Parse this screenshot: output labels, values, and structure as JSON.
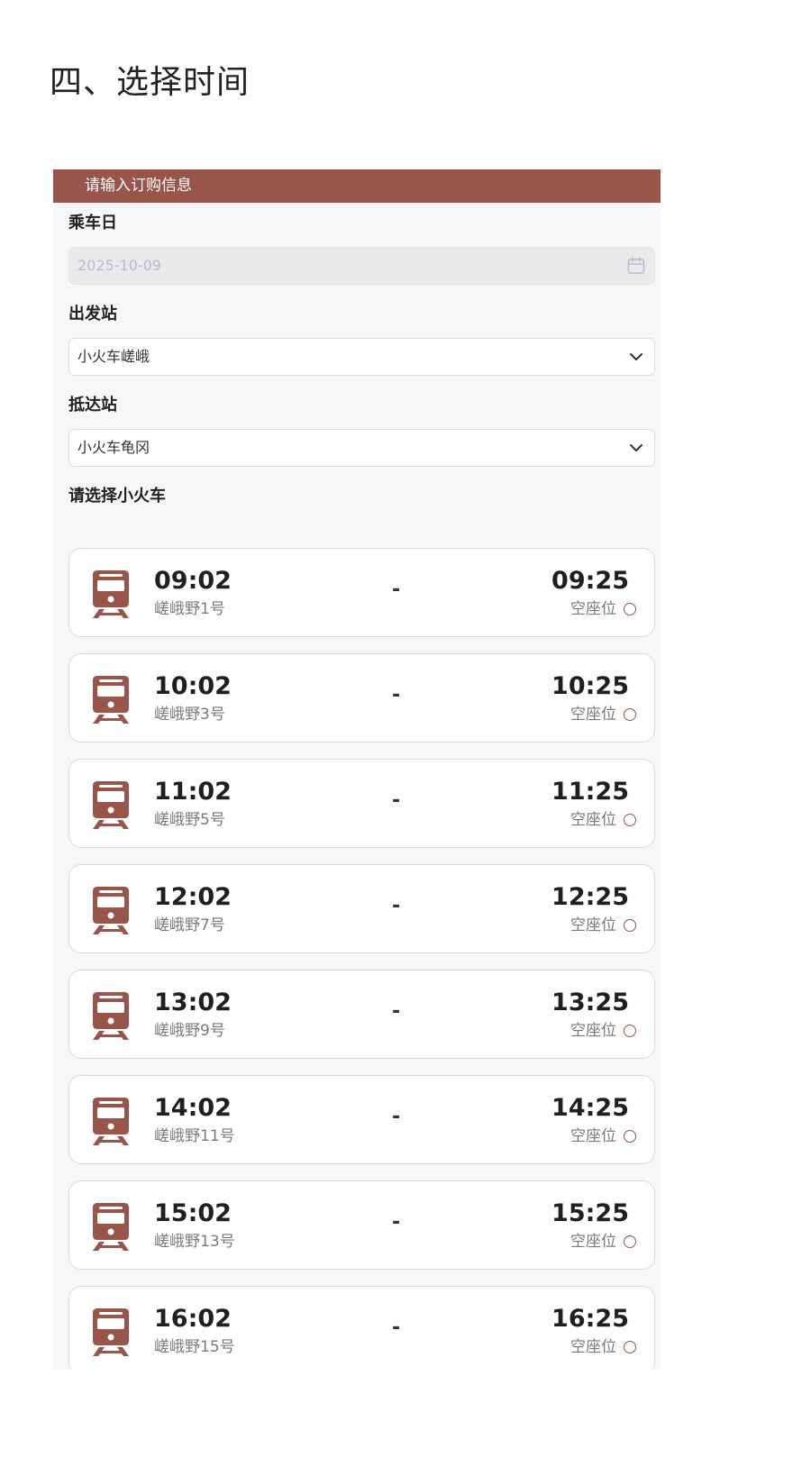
{
  "document": {
    "heading": "四、选择时间"
  },
  "form": {
    "header": "请输入订购信息",
    "date": {
      "label": "乘车日",
      "value": "2025-10-09",
      "icon": "calendar-icon"
    },
    "departure": {
      "label": "出发站",
      "value": "小火车嵯峨",
      "icon": "chevron-down-icon"
    },
    "arrival": {
      "label": "抵达站",
      "value": "小火车龟冈",
      "icon": "chevron-down-icon"
    },
    "train_section_label": "请选择小火车"
  },
  "trains": [
    {
      "dep": "09:02",
      "name": "嵯峨野1号",
      "sep": "-",
      "arr": "09:25",
      "seat": "空座位",
      "mark": "○"
    },
    {
      "dep": "10:02",
      "name": "嵯峨野3号",
      "sep": "-",
      "arr": "10:25",
      "seat": "空座位",
      "mark": "○"
    },
    {
      "dep": "11:02",
      "name": "嵯峨野5号",
      "sep": "-",
      "arr": "11:25",
      "seat": "空座位",
      "mark": "○"
    },
    {
      "dep": "12:02",
      "name": "嵯峨野7号",
      "sep": "-",
      "arr": "12:25",
      "seat": "空座位",
      "mark": "○"
    },
    {
      "dep": "13:02",
      "name": "嵯峨野9号",
      "sep": "-",
      "arr": "13:25",
      "seat": "空座位",
      "mark": "○"
    },
    {
      "dep": "14:02",
      "name": "嵯峨野11号",
      "sep": "-",
      "arr": "14:25",
      "seat": "空座位",
      "mark": "○"
    },
    {
      "dep": "15:02",
      "name": "嵯峨野13号",
      "sep": "-",
      "arr": "15:25",
      "seat": "空座位",
      "mark": "○"
    },
    {
      "dep": "16:02",
      "name": "嵯峨野15号",
      "sep": "-",
      "arr": "16:25",
      "seat": "空座位",
      "mark": "○"
    }
  ],
  "colors": {
    "accent": "#9a554a",
    "panel_bg": "#f7f7f7",
    "date_bg": "#e9eaeb"
  }
}
